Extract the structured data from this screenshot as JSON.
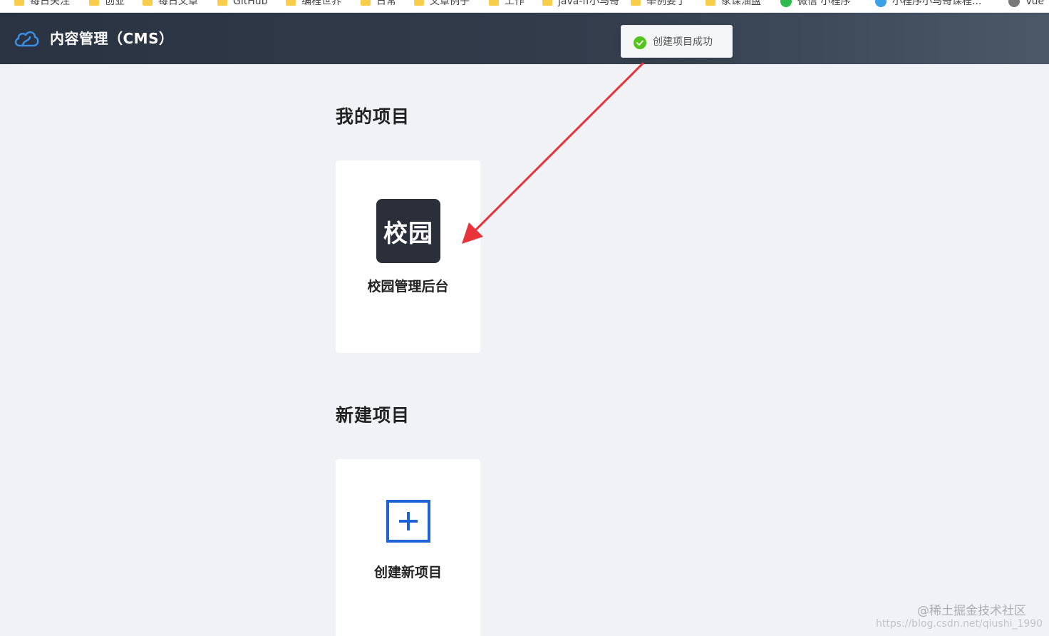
{
  "bookmarks_bar": {
    "items": [
      {
        "label": "每日关注",
        "icon": "folder-icon"
      },
      {
        "label": "创业",
        "icon": "folder-icon"
      },
      {
        "label": "每日文章",
        "icon": "folder-icon"
      },
      {
        "label": "GitHub",
        "icon": "folder-icon"
      },
      {
        "label": "编程世界",
        "icon": "folder-icon"
      },
      {
        "label": "日常",
        "icon": "folder-icon"
      },
      {
        "label": "文章例子",
        "icon": "folder-icon"
      },
      {
        "label": "工作",
        "icon": "folder-icon"
      },
      {
        "label": "java-ff小马哥",
        "icon": "folder-icon"
      },
      {
        "label": "举例要了",
        "icon": "folder-icon"
      },
      {
        "label": "家课油盘",
        "icon": "folder-icon"
      },
      {
        "label": "微信 小程序",
        "icon": "wechat-icon"
      },
      {
        "label": "小程序小马哥课程...",
        "icon": "cloud-icon"
      },
      {
        "label": "Vue",
        "icon": "globe-icon"
      }
    ]
  },
  "header": {
    "title": "内容管理（CMS）",
    "logo_icon": "cloud-logo-icon",
    "accent": "#3a8ee6"
  },
  "toast": {
    "message": "创建项目成功",
    "icon": "check-circle-icon",
    "color": "#52c41a"
  },
  "my_projects": {
    "title": "我的项目",
    "items": [
      {
        "logo_text": "校园",
        "name": "校园管理后台"
      }
    ]
  },
  "new_project": {
    "title": "新建项目",
    "label": "创建新项目",
    "icon": "plus-square-icon",
    "color": "#1f63d6"
  },
  "annotation": {
    "arrow_color": "#e8333a"
  },
  "watermark": {
    "line1": "@稀土掘金技术社区",
    "line2": "https://blog.csdn.net/qiushi_1990"
  }
}
